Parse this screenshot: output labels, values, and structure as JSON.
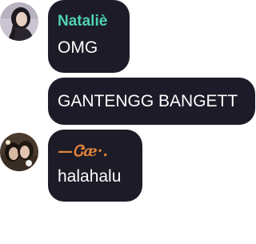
{
  "messages": [
    {
      "author": "Nataliè",
      "author_color": "#4fd1b4",
      "avatar_icon": "avatar-natalie",
      "text": "OMG"
    },
    {
      "author": "",
      "text": "GANTENGG BANGETT"
    },
    {
      "author": "—Ꮳæ·.",
      "author_color": "#e0813a",
      "avatar_icon": "avatar-nae",
      "text": "halahalu"
    }
  ],
  "colors": {
    "bubble_bg": "#1c1b27",
    "text": "#ffffff",
    "background": "#ffffff"
  }
}
